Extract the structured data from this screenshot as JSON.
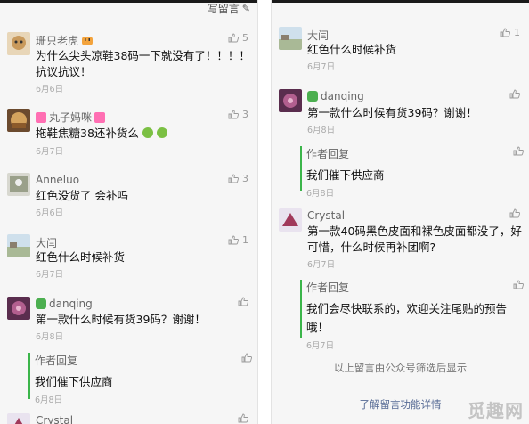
{
  "left": {
    "write_comment": "写留言",
    "comments": [
      {
        "name": "珊只老虎",
        "text_lines": [
          "为什么尖头凉鞋38码一下就没有了！！！！",
          "抗议抗议！"
        ],
        "date": "6月6日",
        "likes": "5"
      },
      {
        "name": "丸子妈咪",
        "text_lines": [
          "拖鞋焦糖38还补货么"
        ],
        "date": "6月7日",
        "likes": "3"
      },
      {
        "name": "Anneluo",
        "text_lines": [
          "红色没货了 会补吗"
        ],
        "date": "6月6日",
        "likes": "3"
      },
      {
        "name": "大闫",
        "text_lines": [
          "红色什么时候补货"
        ],
        "date": "6月7日",
        "likes": "1"
      },
      {
        "name": "danqing",
        "text_lines": [
          "第一款什么时候有货39码？谢谢！"
        ],
        "date": "6月8日",
        "likes": ""
      },
      {
        "name": "Crystal",
        "text_lines": [],
        "date": "",
        "likes": ""
      }
    ],
    "replies": [
      {
        "label": "作者回复",
        "text": "我们催下供应商",
        "date": "6月8日"
      }
    ]
  },
  "right": {
    "comments": [
      {
        "name": "大闫",
        "text_lines": [
          "红色什么时候补货"
        ],
        "date": "6月7日",
        "likes": "1"
      },
      {
        "name": "danqing",
        "text_lines": [
          "第一款什么时候有货39码？谢谢！"
        ],
        "date": "6月8日",
        "likes": ""
      },
      {
        "name": "Crystal",
        "text_lines": [
          "第一款40码黑色皮面和裸色皮面都没了，好",
          "可惜，什么时候再补团啊?"
        ],
        "date": "6月7日",
        "likes": ""
      }
    ],
    "replies": [
      {
        "label": "作者回复",
        "text": "我们催下供应商",
        "date": "6月8日"
      },
      {
        "label": "作者回复",
        "text_lines": [
          "我们会尽快联系的，欢迎关注尾贴的预告",
          "哦！"
        ],
        "date": "6月7日"
      }
    ],
    "footer_note": "以上留言由公众号筛选后显示",
    "footer_link": "了解留言功能详情"
  },
  "watermark": "觅趣网",
  "colors": {
    "accent_green": "#3bb54a",
    "link_blue": "#576b95"
  }
}
